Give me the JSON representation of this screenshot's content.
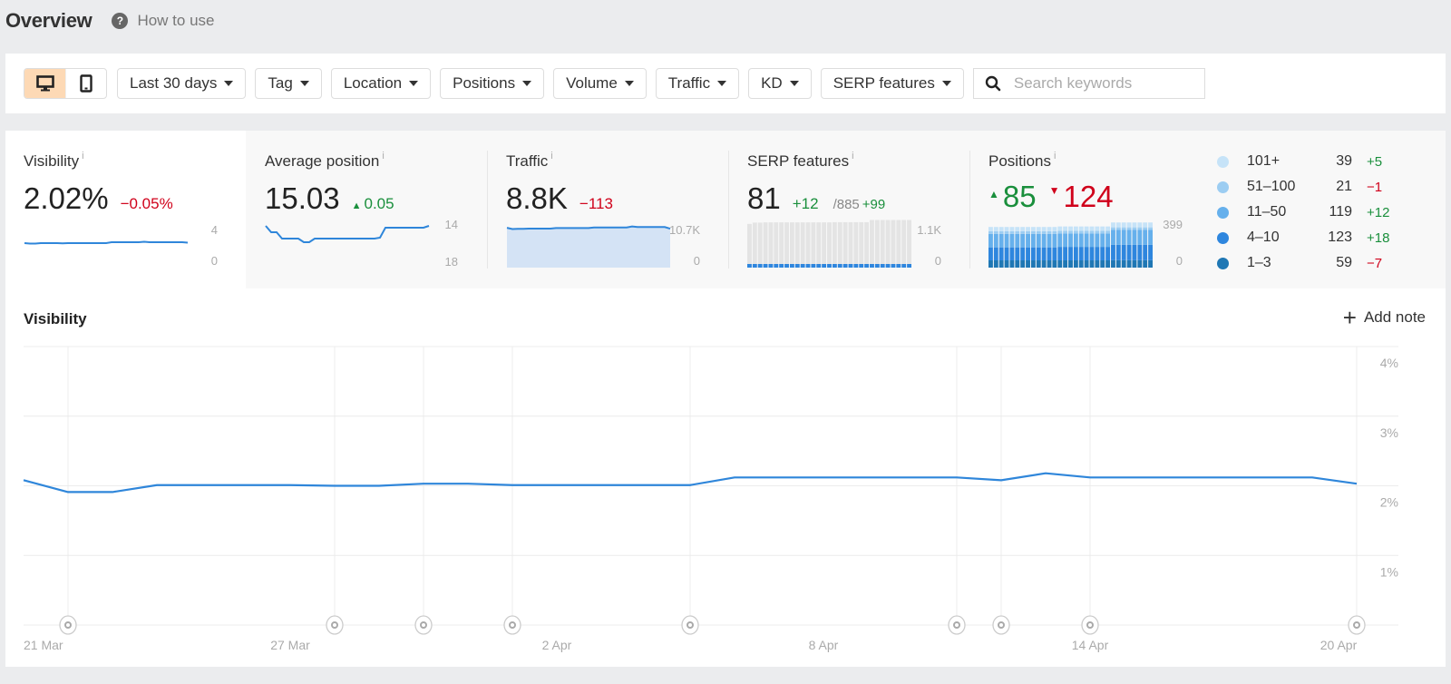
{
  "header": {
    "title": "Overview",
    "how_to_use": "How to use"
  },
  "toolbar": {
    "device_options": [
      {
        "name": "desktop",
        "icon": "desktop-icon",
        "active": true
      },
      {
        "name": "mobile",
        "icon": "mobile-icon",
        "active": false
      }
    ],
    "filters": [
      {
        "key": "date-range",
        "label": "Last 30 days"
      },
      {
        "key": "tag",
        "label": "Tag"
      },
      {
        "key": "location",
        "label": "Location"
      },
      {
        "key": "positions",
        "label": "Positions"
      },
      {
        "key": "volume",
        "label": "Volume"
      },
      {
        "key": "traffic",
        "label": "Traffic"
      },
      {
        "key": "kd",
        "label": "KD"
      },
      {
        "key": "serp-features",
        "label": "SERP features"
      }
    ],
    "search": {
      "placeholder": "Search keywords",
      "value": ""
    },
    "active_color": "#fdd9b5"
  },
  "metrics": {
    "visibility": {
      "label": "Visibility",
      "info": "i",
      "value": "2.02%",
      "delta": "−0.05%",
      "delta_sign": "negative",
      "axis_top": "4",
      "axis_bottom": "0",
      "spark": {
        "min": 0,
        "max": 4,
        "values": [
          2.1,
          2.05,
          2.05,
          2.1,
          2.1,
          2.1,
          2.1,
          2.08,
          2.1,
          2.1,
          2.1,
          2.1,
          2.1,
          2.1,
          2.1,
          2.1,
          2.2,
          2.2,
          2.2,
          2.2,
          2.2,
          2.2,
          2.25,
          2.2,
          2.2,
          2.2,
          2.2,
          2.2,
          2.2,
          2.2,
          2.15
        ]
      }
    },
    "average_position": {
      "label": "Average position",
      "info": "i",
      "value": "15.03",
      "delta": "0.05",
      "delta_sign": "positive",
      "axis_top": "14",
      "axis_bottom": "18",
      "spark": {
        "min": 14,
        "max": 18,
        "inverted": true,
        "values": [
          14.2,
          14.9,
          14.9,
          15.6,
          15.6,
          15.6,
          15.6,
          16.0,
          16.0,
          15.6,
          15.6,
          15.6,
          15.6,
          15.6,
          15.6,
          15.6,
          15.6,
          15.6,
          15.6,
          15.6,
          15.6,
          15.5,
          14.4,
          14.4,
          14.4,
          14.4,
          14.4,
          14.4,
          14.4,
          14.4,
          14.2
        ]
      }
    },
    "traffic": {
      "label": "Traffic",
      "info": "i",
      "value": "8.8K",
      "delta": "−113",
      "delta_sign": "negative",
      "axis_top": "10.7K",
      "axis_bottom": "0",
      "spark": {
        "min": 0,
        "max": 10700,
        "values": [
          9300,
          9000,
          9050,
          9050,
          9100,
          9100,
          9100,
          9100,
          9100,
          9250,
          9250,
          9250,
          9250,
          9250,
          9250,
          9250,
          9400,
          9400,
          9400,
          9400,
          9400,
          9400,
          9400,
          9650,
          9500,
          9500,
          9500,
          9500,
          9500,
          9500,
          9100
        ]
      }
    },
    "serp_features": {
      "label": "SERP features",
      "info": "i",
      "value": "81",
      "delta": "+12",
      "delta_sign": "positive",
      "total": "/885",
      "total_delta": "+99",
      "axis_top": "1.1K",
      "axis_bottom": "0",
      "bars": {
        "max": 1100,
        "total": [
          1000,
          1030,
          1030,
          1035,
          1035,
          1035,
          1035,
          1035,
          1035,
          1035,
          1035,
          1035,
          1035,
          1035,
          1035,
          1035,
          1040,
          1040,
          1040,
          1040,
          1040,
          1040,
          1040,
          1090,
          1090,
          1090,
          1090,
          1090,
          1090,
          1090,
          1090
        ],
        "owned": [
          70,
          72,
          72,
          72,
          72,
          72,
          72,
          72,
          72,
          75,
          75,
          75,
          75,
          75,
          75,
          75,
          78,
          78,
          78,
          78,
          78,
          78,
          80,
          82,
          80,
          80,
          80,
          80,
          80,
          80,
          81
        ]
      }
    },
    "positions": {
      "label": "Positions",
      "info": "i",
      "up": "85",
      "down": "124",
      "axis_top": "399",
      "axis_bottom": "0",
      "bars": {
        "max": 399,
        "series": [
          {
            "name": "1-3",
            "color": "#1f77b4",
            "values": [
              58,
              58,
              58,
              58,
              58,
              58,
              58,
              58,
              58,
              58,
              58,
              58,
              58,
              58,
              58,
              58,
              58,
              58,
              58,
              58,
              58,
              58,
              58,
              59,
              59,
              59,
              59,
              59,
              59,
              59,
              59
            ]
          },
          {
            "name": "4-10",
            "color": "#2e86de",
            "values": [
              104,
              104,
              104,
              104,
              104,
              104,
              104,
              104,
              104,
              104,
              104,
              104,
              104,
              108,
              108,
              108,
              108,
              108,
              108,
              108,
              108,
              108,
              108,
              123,
              123,
              123,
              123,
              123,
              123,
              123,
              123
            ]
          },
          {
            "name": "11-50",
            "color": "#66b0ec",
            "values": [
              107,
              107,
              107,
              107,
              107,
              107,
              107,
              107,
              107,
              107,
              107,
              107,
              107,
              107,
              107,
              107,
              107,
              107,
              107,
              107,
              107,
              107,
              107,
              119,
              119,
              119,
              119,
              119,
              119,
              119,
              119
            ]
          },
          {
            "name": "51-100",
            "color": "#9ccdf2",
            "values": [
              22,
              22,
              22,
              22,
              22,
              22,
              22,
              22,
              22,
              22,
              22,
              22,
              22,
              22,
              22,
              22,
              22,
              22,
              22,
              22,
              22,
              22,
              22,
              21,
              21,
              21,
              21,
              21,
              21,
              21,
              21
            ]
          },
          {
            "name": "101+",
            "color": "#c6e3f8",
            "values": [
              34,
              34,
              34,
              34,
              34,
              34,
              34,
              34,
              34,
              34,
              34,
              34,
              34,
              34,
              34,
              34,
              34,
              34,
              34,
              34,
              34,
              34,
              34,
              39,
              39,
              39,
              39,
              39,
              39,
              39,
              39
            ]
          }
        ]
      }
    },
    "positions_legend": [
      {
        "name": "101+",
        "count": "39",
        "delta": "+5",
        "delta_sign": "positive",
        "color": "#c6e3f8"
      },
      {
        "name": "51–100",
        "count": "21",
        "delta": "−1",
        "delta_sign": "negative",
        "color": "#9ccdf2"
      },
      {
        "name": "11–50",
        "count": "119",
        "delta": "+12",
        "delta_sign": "positive",
        "color": "#66b0ec"
      },
      {
        "name": "4–10",
        "count": "123",
        "delta": "+18",
        "delta_sign": "positive",
        "color": "#2e86de"
      },
      {
        "name": "1–3",
        "count": "59",
        "delta": "−7",
        "delta_sign": "negative",
        "color": "#1f77b4"
      }
    ]
  },
  "main_chart": {
    "title": "Visibility",
    "add_note": "Add note",
    "line_color": "#2f86da"
  },
  "chart_data": {
    "type": "line",
    "title": "Visibility",
    "xlabel": "",
    "ylabel": "",
    "ylim": [
      0,
      4
    ],
    "y_ticks": [
      "1%",
      "2%",
      "3%",
      "4%"
    ],
    "y_tick_values": [
      1,
      2,
      3,
      4
    ],
    "grid": true,
    "x": [
      "21 Mar",
      "22 Mar",
      "23 Mar",
      "24 Mar",
      "25 Mar",
      "26 Mar",
      "27 Mar",
      "28 Mar",
      "29 Mar",
      "30 Mar",
      "31 Mar",
      "1 Apr",
      "2 Apr",
      "3 Apr",
      "4 Apr",
      "5 Apr",
      "6 Apr",
      "7 Apr",
      "8 Apr",
      "9 Apr",
      "10 Apr",
      "11 Apr",
      "12 Apr",
      "13 Apr",
      "14 Apr",
      "15 Apr",
      "16 Apr",
      "17 Apr",
      "18 Apr",
      "19 Apr",
      "20 Apr"
    ],
    "x_tick_labels": [
      "21 Mar",
      "27 Mar",
      "2 Apr",
      "8 Apr",
      "14 Apr",
      "20 Apr"
    ],
    "x_tick_indices": [
      0,
      6,
      12,
      18,
      24,
      30
    ],
    "series": [
      {
        "name": "Visibility",
        "unit": "%",
        "values": [
          2.08,
          1.91,
          1.91,
          2.01,
          2.01,
          2.01,
          2.01,
          2.0,
          2.0,
          2.03,
          2.03,
          2.01,
          2.01,
          2.01,
          2.01,
          2.01,
          2.12,
          2.12,
          2.12,
          2.12,
          2.12,
          2.12,
          2.08,
          2.18,
          2.12,
          2.12,
          2.12,
          2.12,
          2.12,
          2.12,
          2.03
        ]
      }
    ],
    "note_indices": [
      1,
      7,
      9,
      11,
      15,
      21,
      22,
      24,
      30
    ],
    "legend": "none"
  }
}
